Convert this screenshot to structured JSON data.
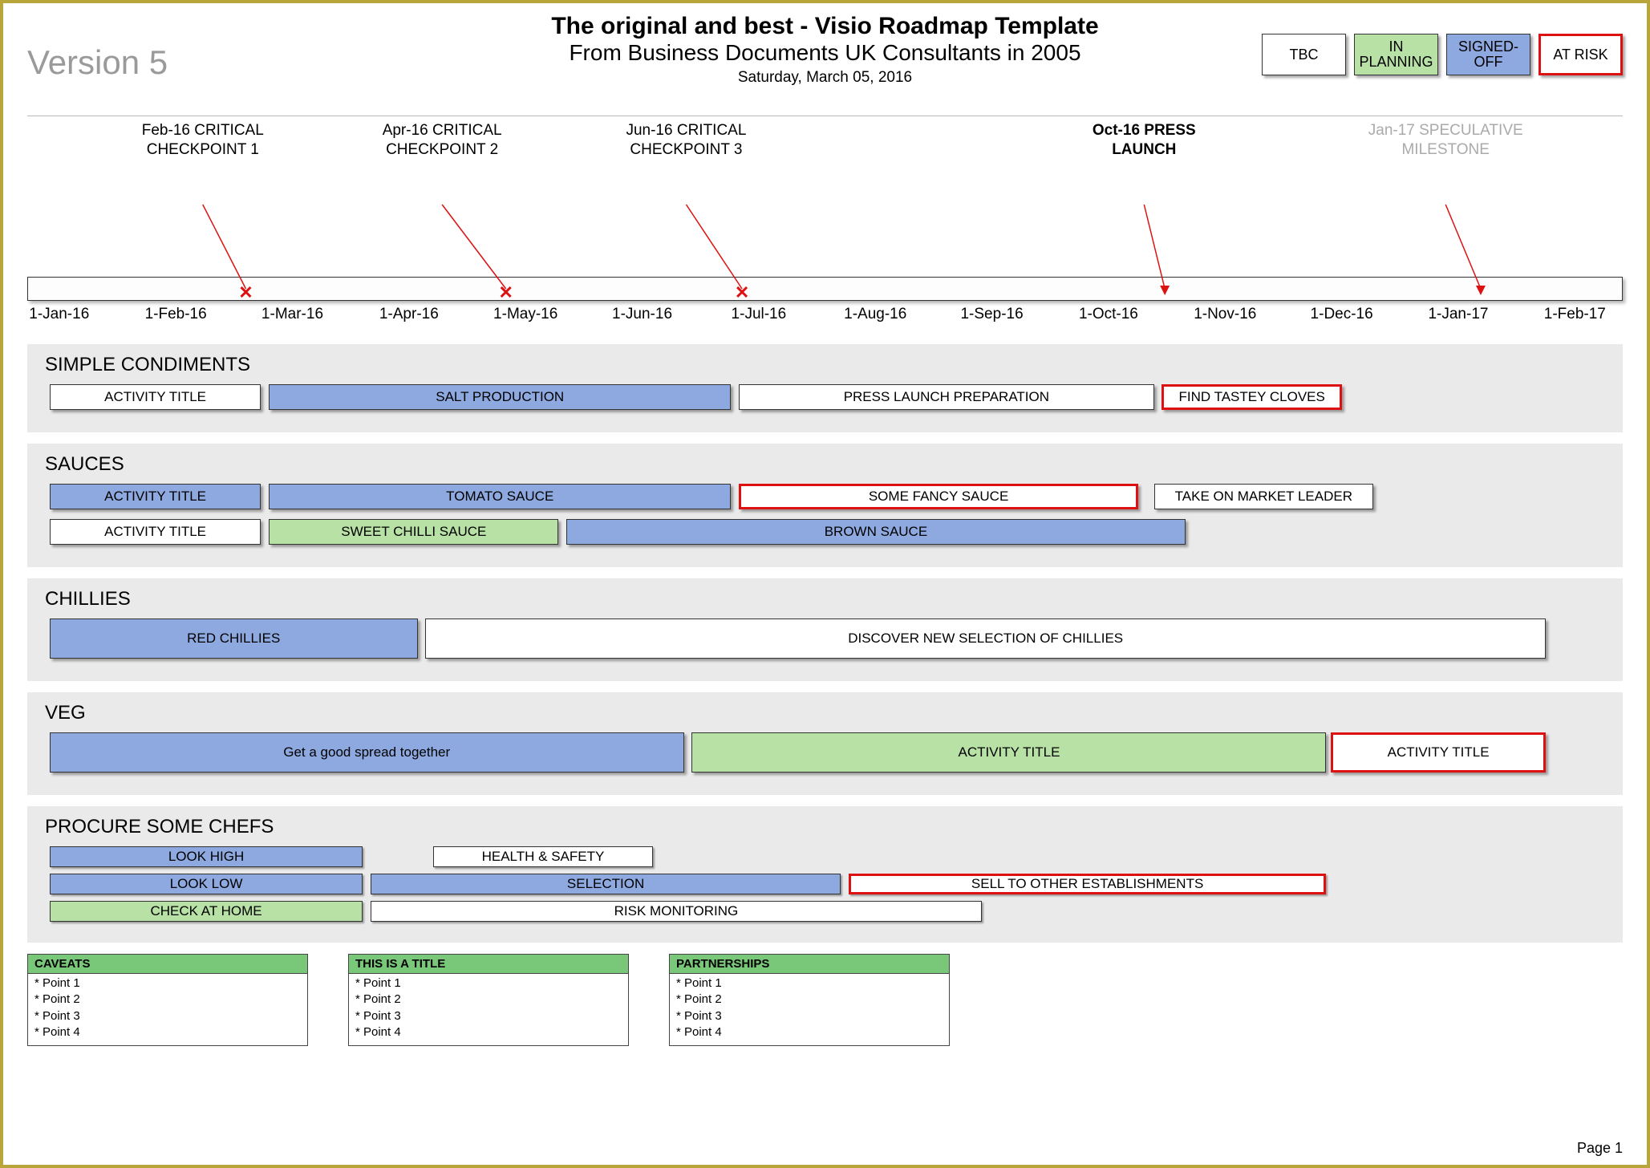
{
  "version": "Version 5",
  "title": "The original and best - Visio Roadmap Template",
  "subtitle": "From Business Documents UK Consultants in 2005",
  "date": "Saturday, March 05, 2016",
  "legend": {
    "tbc": "TBC",
    "planning": "IN\nPLANNING",
    "signed": "SIGNED-\nOFF",
    "risk": "AT RISK"
  },
  "milestones": [
    {
      "label": "Feb-16\nCRITICAL\nCHECKPOINT\n1",
      "pos_pct": 11.0,
      "end_pct": 13.7,
      "marker": "x",
      "class": ""
    },
    {
      "label": "Apr-16\nCRITICAL\nCHECKPOINT\n2",
      "pos_pct": 26.0,
      "end_pct": 30.0,
      "marker": "x",
      "class": ""
    },
    {
      "label": "Jun-16\nCRITICAL\nCHECKPOINT\n3",
      "pos_pct": 41.3,
      "end_pct": 44.8,
      "marker": "x",
      "class": ""
    },
    {
      "label": "Oct-16\nPRESS\nLAUNCH",
      "pos_pct": 70.0,
      "end_pct": 71.3,
      "marker": "arrow",
      "class": "bold"
    },
    {
      "label": "Jan-17\nSPECULATIVE\nMILESTONE",
      "pos_pct": 88.9,
      "end_pct": 91.1,
      "marker": "arrow",
      "class": "grey"
    }
  ],
  "ticks": [
    "1-Jan-16",
    "1-Feb-16",
    "1-Mar-16",
    "1-Apr-16",
    "1-May-16",
    "1-Jun-16",
    "1-Jul-16",
    "1-Aug-16",
    "1-Sep-16",
    "1-Oct-16",
    "1-Nov-16",
    "1-Dec-16",
    "1-Jan-17",
    "1-Feb-17"
  ],
  "lanes": [
    {
      "title": "SIMPLE CONDIMENTS",
      "rows": [
        [
          {
            "label": "ACTIVITY TITLE",
            "start": 0.5,
            "end": 14,
            "status": "tbc"
          },
          {
            "label": "SALT PRODUCTION",
            "start": 14.5,
            "end": 44,
            "status": "signed"
          },
          {
            "label": "PRESS LAUNCH PREPARATION",
            "start": 44.5,
            "end": 71,
            "status": "tbc"
          },
          {
            "label": "FIND TASTEY CLOVES",
            "start": 71.5,
            "end": 83,
            "status": "risk"
          }
        ]
      ]
    },
    {
      "title": "SAUCES",
      "rows": [
        [
          {
            "label": "ACTIVITY TITLE",
            "start": 0.5,
            "end": 14,
            "status": "signed"
          },
          {
            "label": "TOMATO SAUCE",
            "start": 14.5,
            "end": 44,
            "status": "signed"
          },
          {
            "label": "SOME FANCY SAUCE",
            "start": 44.5,
            "end": 70,
            "status": "risk"
          },
          {
            "label": "TAKE ON MARKET LEADER",
            "start": 71,
            "end": 85,
            "status": "tbc"
          }
        ],
        [
          {
            "label": "ACTIVITY TITLE",
            "start": 0.5,
            "end": 14,
            "status": "tbc"
          },
          {
            "label": "SWEET CHILLI SAUCE",
            "start": 14.5,
            "end": 33,
            "status": "planning"
          },
          {
            "label": "BROWN SAUCE",
            "start": 33.5,
            "end": 73,
            "status": "signed"
          }
        ]
      ]
    },
    {
      "title": "CHILLIES",
      "tall": true,
      "rows": [
        [
          {
            "label": "RED CHILLIES",
            "start": 0.5,
            "end": 24,
            "status": "signed"
          },
          {
            "label": "DISCOVER NEW SELECTION OF CHILLIES",
            "start": 24.5,
            "end": 96,
            "status": "tbc"
          }
        ]
      ]
    },
    {
      "title": "VEG",
      "tall": true,
      "rows": [
        [
          {
            "label": "Get a good spread together",
            "start": 0.5,
            "end": 41,
            "status": "signed"
          },
          {
            "label": "ACTIVITY TITLE",
            "start": 41.5,
            "end": 82,
            "status": "planning"
          },
          {
            "label": "ACTIVITY TITLE",
            "start": 82.3,
            "end": 96,
            "status": "risk"
          }
        ]
      ]
    },
    {
      "title": "PROCURE SOME CHEFS",
      "thin": true,
      "rows": [
        [
          {
            "label": "LOOK HIGH",
            "start": 0.5,
            "end": 20.5,
            "status": "signed"
          },
          {
            "label": "HEALTH & SAFETY",
            "start": 25,
            "end": 39,
            "status": "tbc"
          }
        ],
        [
          {
            "label": "LOOK LOW",
            "start": 0.5,
            "end": 20.5,
            "status": "signed"
          },
          {
            "label": "SELECTION",
            "start": 21,
            "end": 51,
            "status": "signed"
          },
          {
            "label": "SELL TO OTHER ESTABLISHMENTS",
            "start": 51.5,
            "end": 82,
            "status": "risk"
          }
        ],
        [
          {
            "label": "CHECK AT HOME",
            "start": 0.5,
            "end": 20.5,
            "status": "planning"
          },
          {
            "label": "RISK MONITORING",
            "start": 21,
            "end": 60,
            "status": "tbc"
          }
        ]
      ]
    }
  ],
  "footers": [
    {
      "title": "CAVEATS",
      "points": [
        "* Point 1",
        "* Point 2",
        "* Point 3",
        "* Point 4"
      ]
    },
    {
      "title": "THIS IS A TITLE",
      "points": [
        "* Point 1",
        "* Point 2",
        "* Point 3",
        "* Point 4"
      ]
    },
    {
      "title": "PARTNERSHIPS",
      "points": [
        "* Point 1",
        "* Point 2",
        "* Point 3",
        "* Point 4"
      ]
    }
  ],
  "page": "Page 1"
}
